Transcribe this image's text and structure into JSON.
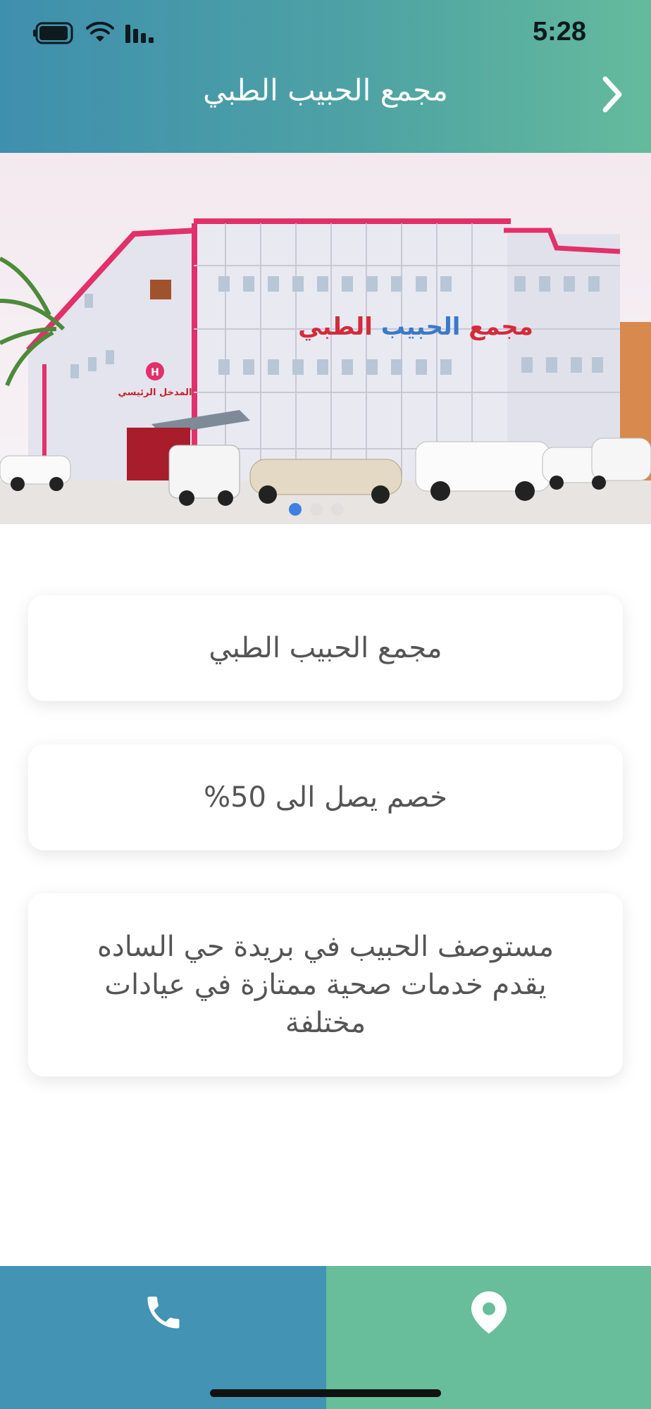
{
  "status_bar": {
    "time": "5:28"
  },
  "header": {
    "title": "مجمع الحبيب الطبي"
  },
  "hero": {
    "sign_part1": "مجمع ",
    "sign_part2": "الحبيب ",
    "sign_part3": "الطبي",
    "entrance_label": "المدخل الرئيسي",
    "slide_count": 3,
    "active_slide": 1
  },
  "cards": {
    "name": "مجمع الحبيب الطبي",
    "discount": "خصم يصل الى 50%",
    "description": "مستوصف الحبيب في بريدة حي الساده يقدم خدمات صحية ممتازة في عيادات مختلفة"
  },
  "bottom_bar": {
    "call_icon": "phone-icon",
    "location_icon": "location-pin-icon"
  },
  "colors": {
    "header_start": "#3f8fae",
    "header_end": "#64bb9c",
    "call_bg": "#4293b4",
    "location_bg": "#68bd9b"
  }
}
